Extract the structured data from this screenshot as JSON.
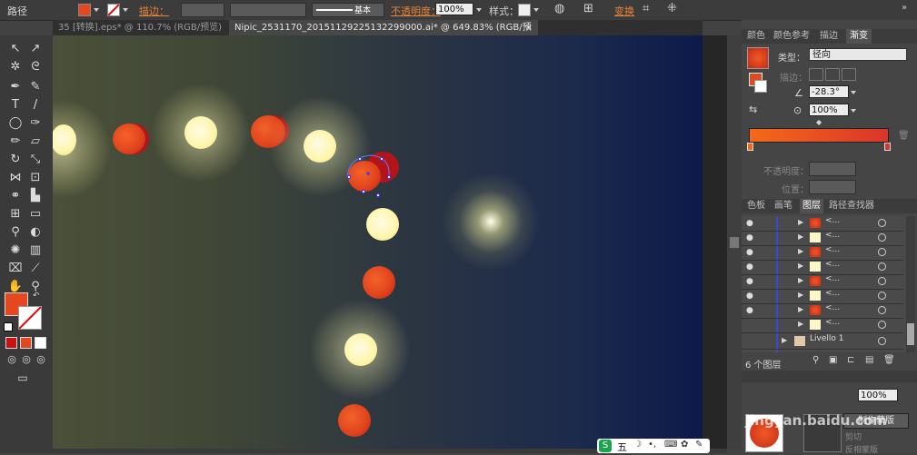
{
  "control_bar": {
    "label_path": "路径",
    "stroke_label": "描边：",
    "stroke_style": "基本",
    "opacity_label": "不透明度：",
    "opacity_value": "100%",
    "style_label": "样式：",
    "transform_label": "变换",
    "fill_color": "#e5481f"
  },
  "tabs": [
    {
      "label": "35 [转换].eps* @ 110.7% (RGB/预览)"
    },
    {
      "label": "Nipic_2531170_20151129225132299000.ai* @ 649.83% (RGB/预览)"
    }
  ],
  "panel_tabs_top": [
    "颜色",
    "颜色参考",
    "描边",
    "渐变"
  ],
  "gradient": {
    "type_label": "类型：",
    "type_value": "径向",
    "stroke_label": "描边：",
    "angle_value": "-28.3°",
    "aspect_value": "100%",
    "opacity_label": "不透明度：",
    "position_label": "位置："
  },
  "panel_tabs_mid": [
    "色板",
    "画笔",
    "图层",
    "路径查找器"
  ],
  "layers": [
    {
      "label": "<...",
      "thumb": "ball"
    },
    {
      "label": "<...",
      "thumb": "sun"
    },
    {
      "label": "<...",
      "thumb": "ball"
    },
    {
      "label": "<...",
      "thumb": "sun"
    },
    {
      "label": "<...",
      "thumb": "ball"
    },
    {
      "label": "<...",
      "thumb": "sun"
    },
    {
      "label": "<...",
      "thumb": "ball"
    },
    {
      "label": "<...",
      "thumb": "sun"
    },
    {
      "label": "Livello 1",
      "thumb": "layer"
    }
  ],
  "layers_count": "6 个图层",
  "transparency": {
    "opacity_value": "100%",
    "make_mask": "制作蒙版",
    "clip_label": "剪切",
    "invert_mask": "反相蒙版"
  },
  "ime_bar": {
    "label": "五"
  },
  "watermark": "jingyan.baidu.com"
}
